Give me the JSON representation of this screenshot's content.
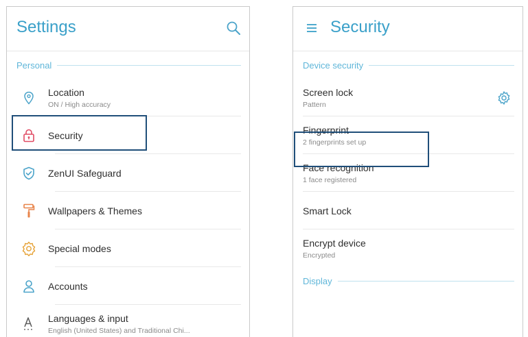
{
  "settings_screen": {
    "title": "Settings",
    "search_icon": "search-icon",
    "section": "Personal",
    "items": [
      {
        "label": "Location",
        "subtitle": "ON / High accuracy",
        "icon": "location-pin-icon"
      },
      {
        "label": "Security",
        "subtitle": "",
        "icon": "padlock-icon",
        "highlighted": true
      },
      {
        "label": "ZenUI Safeguard",
        "subtitle": "",
        "icon": "shield-check-icon"
      },
      {
        "label": "Wallpapers & Themes",
        "subtitle": "",
        "icon": "paint-roller-icon"
      },
      {
        "label": "Special modes",
        "subtitle": "",
        "icon": "special-modes-gear-icon"
      },
      {
        "label": "Accounts",
        "subtitle": "",
        "icon": "person-icon"
      },
      {
        "label": "Languages & input",
        "subtitle": "English (United States) and Traditional Chi...",
        "icon": "language-icon"
      }
    ]
  },
  "security_screen": {
    "title": "Security",
    "menu_icon": "hamburger-menu-icon",
    "section": "Device security",
    "items": [
      {
        "label": "Screen lock",
        "subtitle": "Pattern",
        "action_icon": "gear-icon"
      },
      {
        "label": "Fingerprint",
        "subtitle": "2 fingerprints set up",
        "highlighted": true
      },
      {
        "label": "Face recognition",
        "subtitle": "1 face registered"
      },
      {
        "label": "Smart Lock",
        "subtitle": ""
      },
      {
        "label": "Encrypt device",
        "subtitle": "Encrypted"
      }
    ],
    "next_section": "Display"
  },
  "colors": {
    "accent": "#3aa0c9",
    "section_header": "#5fb6d9",
    "icon": "#4aa3c9",
    "security_icon": "#e04a63",
    "highlight_border": "#1f4e79"
  }
}
